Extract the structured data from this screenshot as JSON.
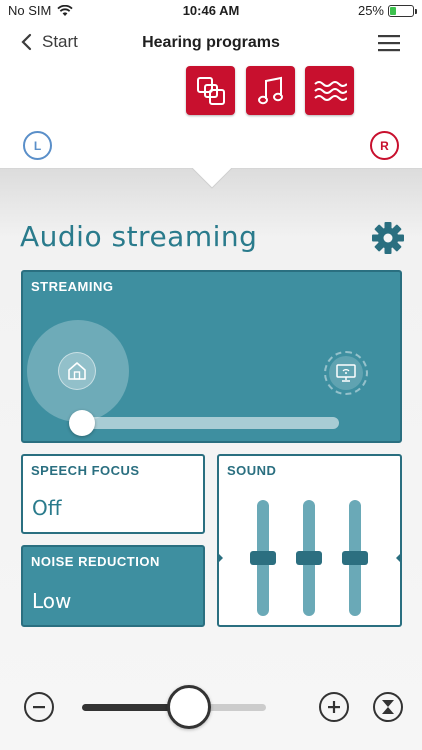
{
  "status": {
    "carrier": "No SIM",
    "time": "10:46 AM",
    "battery": "25%",
    "battery_level": 0.25,
    "wifi_icon": "wifi-icon",
    "battery_icon": "battery-charging-icon"
  },
  "nav": {
    "back_label": "Start",
    "title": "Hearing programs",
    "menu_icon": "hamburger-menu-icon"
  },
  "programs": [
    {
      "icon": "streaming-program-icon",
      "active": true
    },
    {
      "icon": "music-note-icon",
      "active": false
    },
    {
      "icon": "waves-icon",
      "active": false
    }
  ],
  "sides": {
    "left": "L",
    "right": "R"
  },
  "section": {
    "title": "Audio streaming",
    "settings_icon": "gear-icon"
  },
  "streaming": {
    "label": "STREAMING",
    "balance": 0.0,
    "left_icon": "home-icon",
    "right_icon": "tv-streamer-icon"
  },
  "speech_focus": {
    "label": "SPEECH FOCUS",
    "value": "Off"
  },
  "noise_reduction": {
    "label": "NOISE REDUCTION",
    "value": "Low"
  },
  "sound": {
    "label": "SOUND",
    "bands": [
      0.5,
      0.5,
      0.5
    ]
  },
  "volume": {
    "level": 0.58,
    "decrease_icon": "minus-circle-icon",
    "increase_icon": "plus-circle-icon",
    "timer_icon": "hourglass-icon"
  },
  "colors": {
    "accent": "#2a7b8c",
    "panel": "#3e8fa0",
    "brand_red": "#c8102e",
    "left_side": "#5a8fc9"
  }
}
